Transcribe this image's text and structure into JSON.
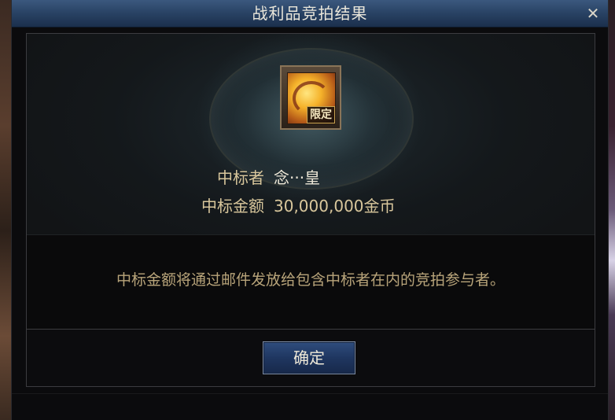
{
  "dialog": {
    "title": "战利品竞拍结果",
    "close_icon": "close-icon",
    "item": {
      "icon": "item-icon",
      "badge": "限定"
    },
    "winner": {
      "label": "中标者",
      "value": "念···皇"
    },
    "amount": {
      "label": "中标金额",
      "value": "30,000,000金币"
    },
    "notice": "中标金额将通过邮件发放给包含中标者在内的竞拍参与者。",
    "confirm_label": "确定"
  },
  "colors": {
    "titlebar": "#2a4466",
    "label_gold": "#d9c79c",
    "button_blue": "#1f3660"
  }
}
